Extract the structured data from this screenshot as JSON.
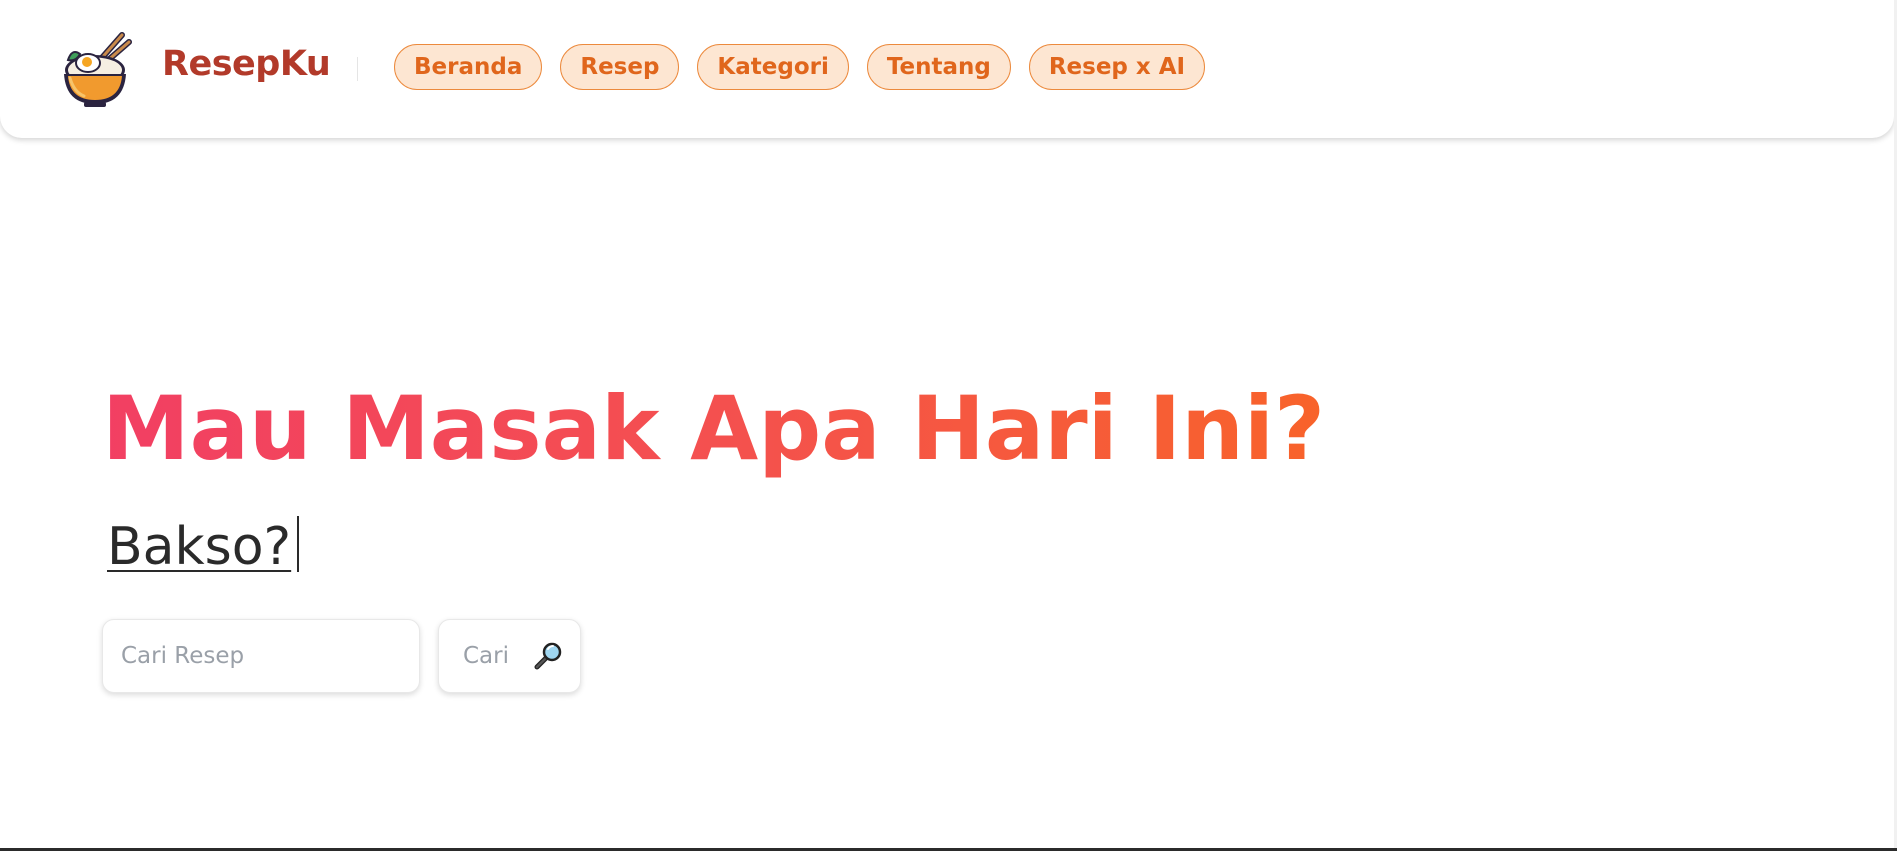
{
  "brand": {
    "name": "ResepKu",
    "logo_icon": "rice-bowl-icon"
  },
  "nav": {
    "items": [
      {
        "label": "Beranda"
      },
      {
        "label": "Resep"
      },
      {
        "label": "Kategori"
      },
      {
        "label": "Tentang"
      },
      {
        "label": "Resep x AI"
      }
    ]
  },
  "hero": {
    "title": "Mau Masak Apa Hari Ini?",
    "typed_text": "Bakso?"
  },
  "search": {
    "placeholder": "Cari Resep",
    "value": "",
    "button_label": "Cari",
    "button_icon": "magnifier-icon"
  },
  "colors": {
    "brand": "#b23a2a",
    "nav_text": "#e0661c",
    "nav_bg": "#fde6d2",
    "nav_border": "#ec8a3d",
    "title_gradient_start": "#f23f63",
    "title_gradient_end": "#f8632a"
  }
}
